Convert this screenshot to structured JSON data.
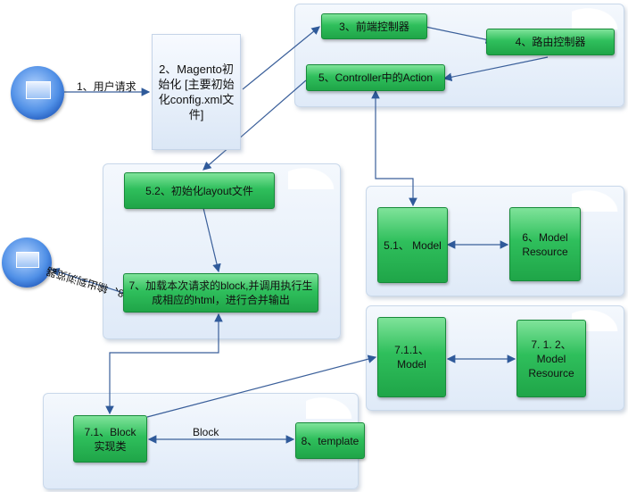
{
  "nodes": {
    "n1_label": "1、用户请求",
    "n2": "2、Magento初始化 [主要初始化config.xml文件]",
    "n3": "3、前端控制器",
    "n4": "4、路由控制器",
    "n5": "5、Controller中的Action",
    "n52": "5.2、初始化layout文件",
    "n7": "7、加载本次请求的block,并调用执行生成相应的html，进行合并输出",
    "n8_label": "8、输出到浏览器",
    "n51": "5.1、 Model",
    "n6": "6、Model Resource",
    "n711": "7.1.1、Model",
    "n712": "7. 1. 2、Model Resource",
    "n71": "7.1、Block 实现类",
    "n8": "8、template",
    "block_label": "Block"
  },
  "icons": [
    "monitor-icon",
    "monitor-icon"
  ],
  "colors": {
    "box": "#2fbf5c",
    "line": "#3a5f9a",
    "cloud": "#dfeaf8"
  }
}
